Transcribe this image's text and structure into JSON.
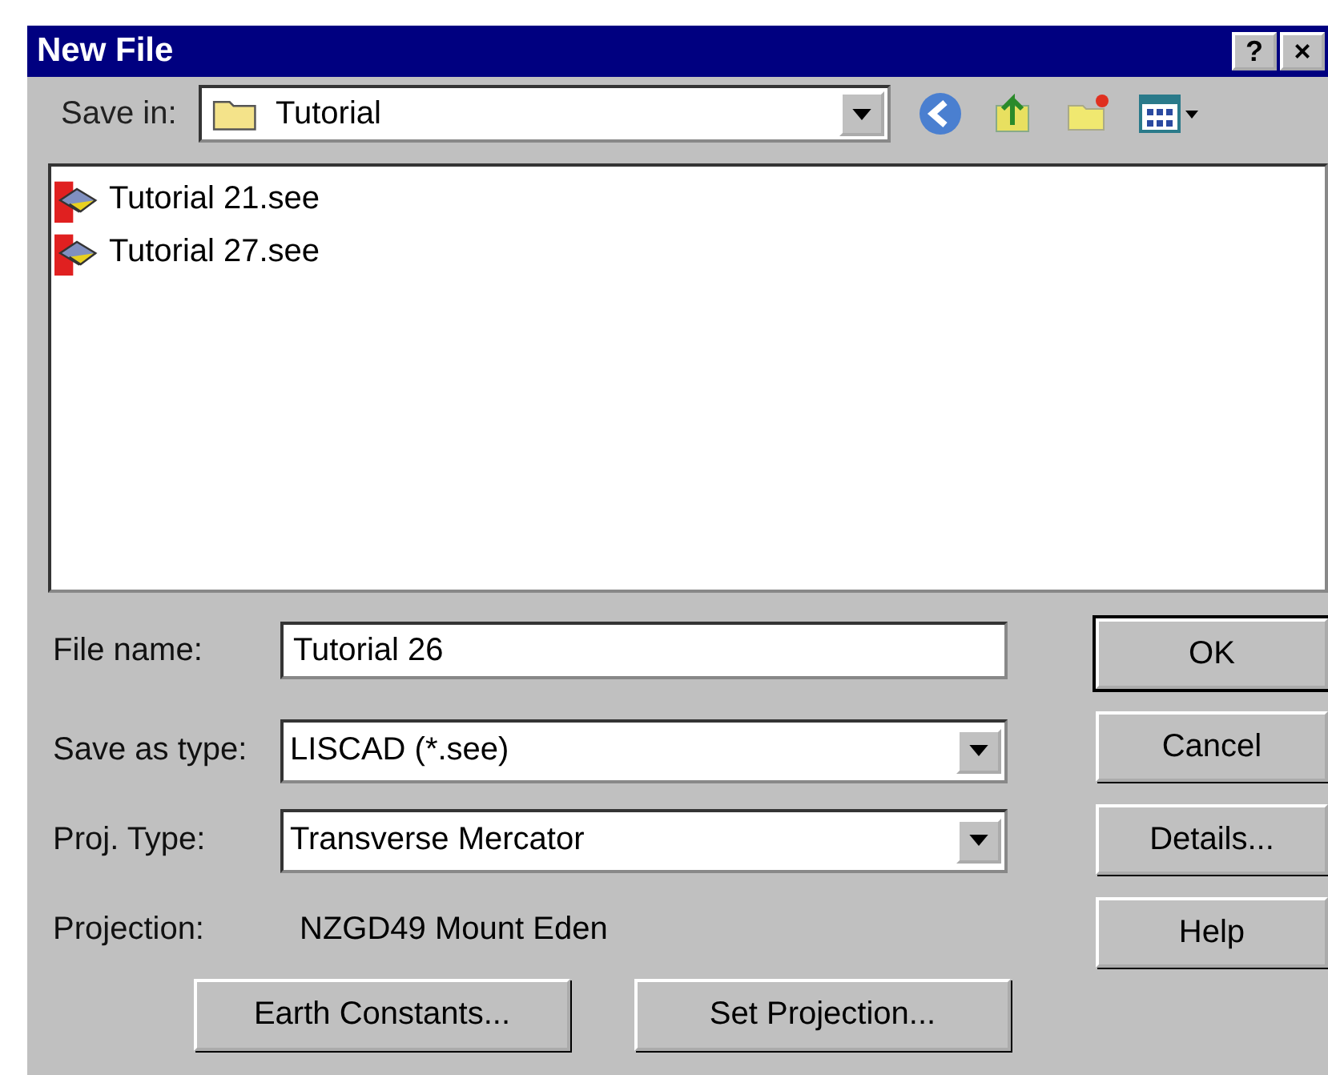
{
  "window": {
    "title": "New File",
    "title_buttons": [
      "?",
      "×"
    ]
  },
  "save_in": {
    "label": "Save in:",
    "value": "Tutorial"
  },
  "files": [
    {
      "name": "Tutorial 21.see",
      "selected": false
    },
    {
      "name": "Tutorial 27.see",
      "selected": false
    }
  ],
  "fields": [
    {
      "kind": "input",
      "label": "File name:",
      "value": "Tutorial 26"
    },
    {
      "kind": "dropdown",
      "label": "Save as type:",
      "value": "LISCAD (*.see)"
    },
    {
      "kind": "dropdown",
      "label": "Proj. Type:",
      "value": "Transverse Mercator"
    },
    {
      "kind": "static",
      "label": "Projection:",
      "value": "NZGD49 Mount Eden"
    }
  ],
  "side_buttons": [
    {
      "label": "OK",
      "default": true
    },
    {
      "label": "Cancel",
      "default": false
    },
    {
      "label": "Details...",
      "default": false
    },
    {
      "label": "Help",
      "default": false
    }
  ],
  "bottom_buttons": [
    "Earth Constants...",
    "Set Projection..."
  ]
}
